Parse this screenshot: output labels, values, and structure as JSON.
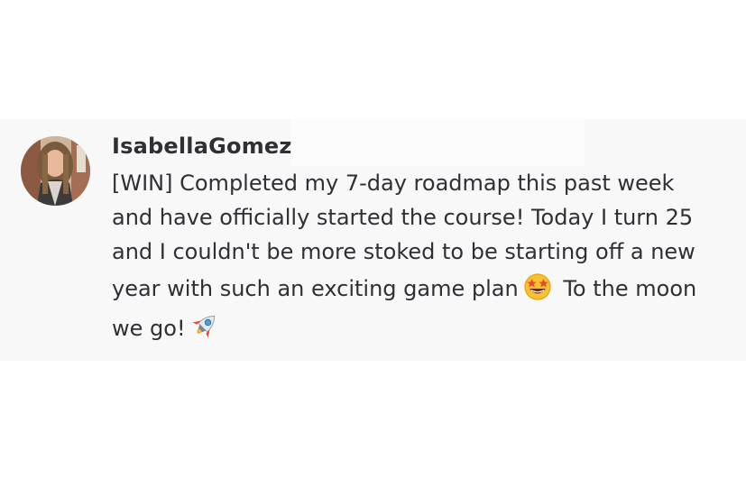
{
  "message": {
    "author": "IsabellaGomez",
    "lines": [
      "[WIN] Completed my 7-day roadmap this past week",
      "and have officially started the course! Today I turn 25",
      "and I couldn't be more stoked to be starting off a new",
      "year with such an exciting game plan",
      "To the moon",
      "we go!"
    ],
    "emojis": [
      "star-struck-emoji-icon",
      "rocket-emoji-icon"
    ]
  },
  "colors": {
    "message_background": "#f8f8f8",
    "text": "#2e3035"
  }
}
